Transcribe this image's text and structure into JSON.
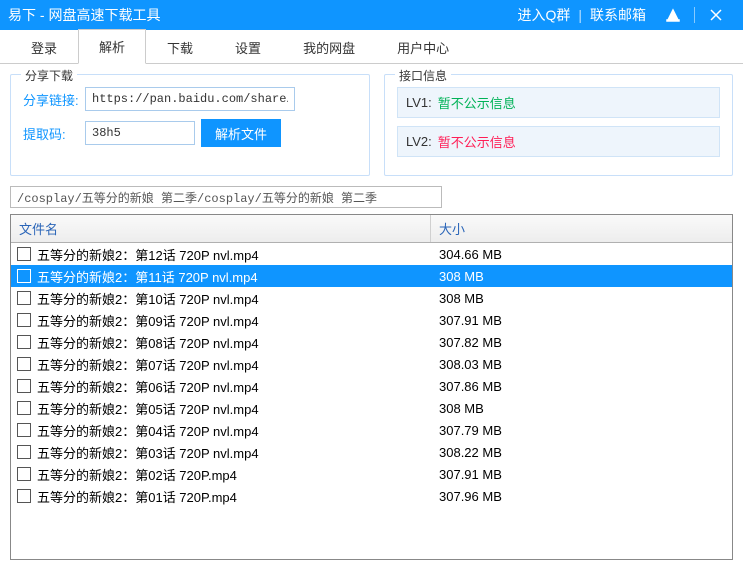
{
  "titlebar": {
    "title": "易下 - 网盘高速下载工具",
    "links": {
      "qgroup": "进入Q群",
      "mail": "联系邮箱"
    }
  },
  "tabs": [
    "登录",
    "解析",
    "下载",
    "设置",
    "我的网盘",
    "用户中心"
  ],
  "active_tab_index": 1,
  "share_panel": {
    "legend": "分享下载",
    "link_label": "分享链接:",
    "link_value": "https://pan.baidu.com/share/init?",
    "code_label": "提取码:",
    "code_value": "38h5",
    "parse_btn": "解析文件"
  },
  "api_panel": {
    "legend": "接口信息",
    "lv1_label": "LV1:",
    "lv1_value": "暂不公示信息",
    "lv2_label": "LV2:",
    "lv2_value": "暂不公示信息"
  },
  "path_value": "/cosplay/五等分的新娘 第二季/cosplay/五等分的新娘 第二季",
  "table": {
    "col_name": "文件名",
    "col_size": "大小"
  },
  "files": [
    {
      "name": "五等分的新娘2：第12话 720P nvl.mp4",
      "size": "304.66 MB",
      "selected": false
    },
    {
      "name": "五等分的新娘2：第11话 720P nvl.mp4",
      "size": "308 MB",
      "selected": true
    },
    {
      "name": "五等分的新娘2：第10话 720P nvl.mp4",
      "size": "308 MB",
      "selected": false
    },
    {
      "name": "五等分的新娘2：第09话 720P nvl.mp4",
      "size": "307.91 MB",
      "selected": false
    },
    {
      "name": "五等分的新娘2：第08话 720P nvl.mp4",
      "size": "307.82 MB",
      "selected": false
    },
    {
      "name": "五等分的新娘2：第07话 720P nvl.mp4",
      "size": "308.03 MB",
      "selected": false
    },
    {
      "name": "五等分的新娘2：第06话 720P nvl.mp4",
      "size": "307.86 MB",
      "selected": false
    },
    {
      "name": "五等分的新娘2：第05话 720P nvl.mp4",
      "size": "308 MB",
      "selected": false
    },
    {
      "name": "五等分的新娘2：第04话 720P nvl.mp4",
      "size": "307.79 MB",
      "selected": false
    },
    {
      "name": "五等分的新娘2：第03话 720P nvl.mp4",
      "size": "308.22 MB",
      "selected": false
    },
    {
      "name": "五等分的新娘2：第02话 720P.mp4",
      "size": "307.91 MB",
      "selected": false
    },
    {
      "name": "五等分的新娘2：第01话 720P.mp4",
      "size": "307.96 MB",
      "selected": false
    }
  ]
}
